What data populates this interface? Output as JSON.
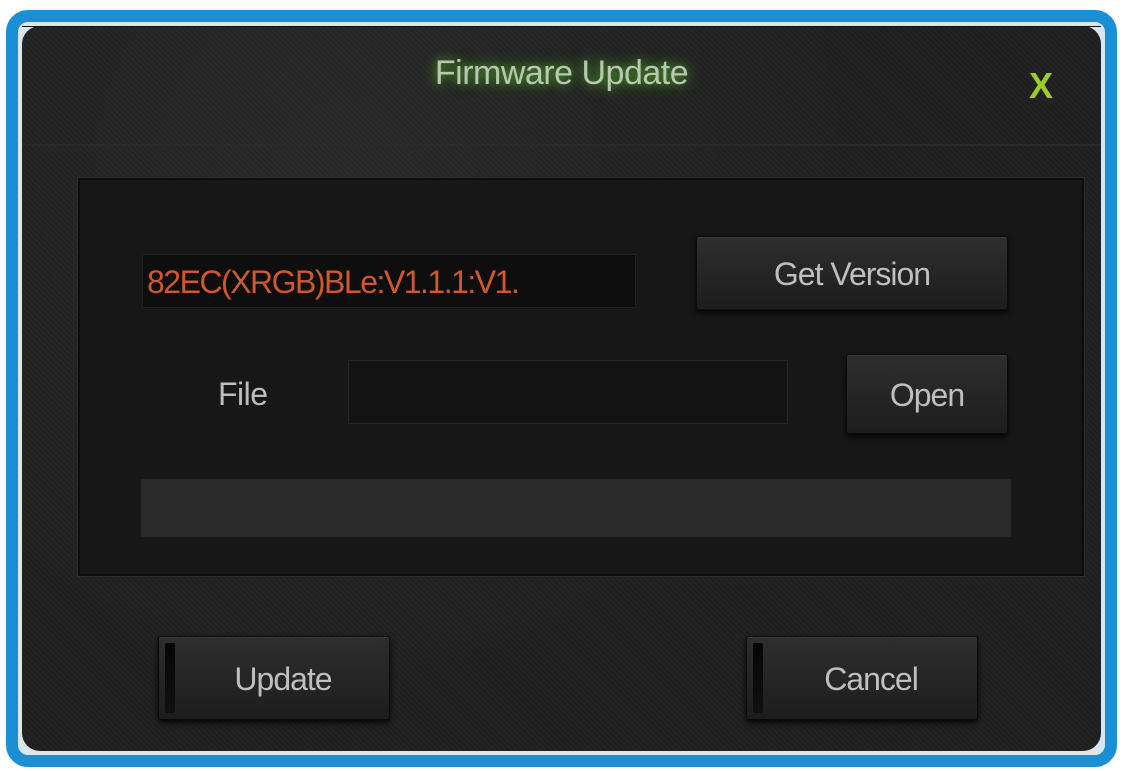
{
  "dialog": {
    "title": "Firmware Update",
    "close_label": "X"
  },
  "version": {
    "value": "82EC(XRGB)BLe:V1.1.1:V1.",
    "button_label": "Get Version"
  },
  "file": {
    "label": "File",
    "value": "",
    "button_label": "Open"
  },
  "progress": {
    "value_percent": 0
  },
  "actions": {
    "update_label": "Update",
    "cancel_label": "Cancel"
  },
  "colors": {
    "window_border": "#1a8fd6",
    "background": "#1f1f1f",
    "title_glow": "#78ff3c",
    "close_icon": "#9ccc2a",
    "version_text": "#d0582a",
    "button_text": "#bfbfbf"
  },
  "icons": {
    "close": "close-icon"
  }
}
